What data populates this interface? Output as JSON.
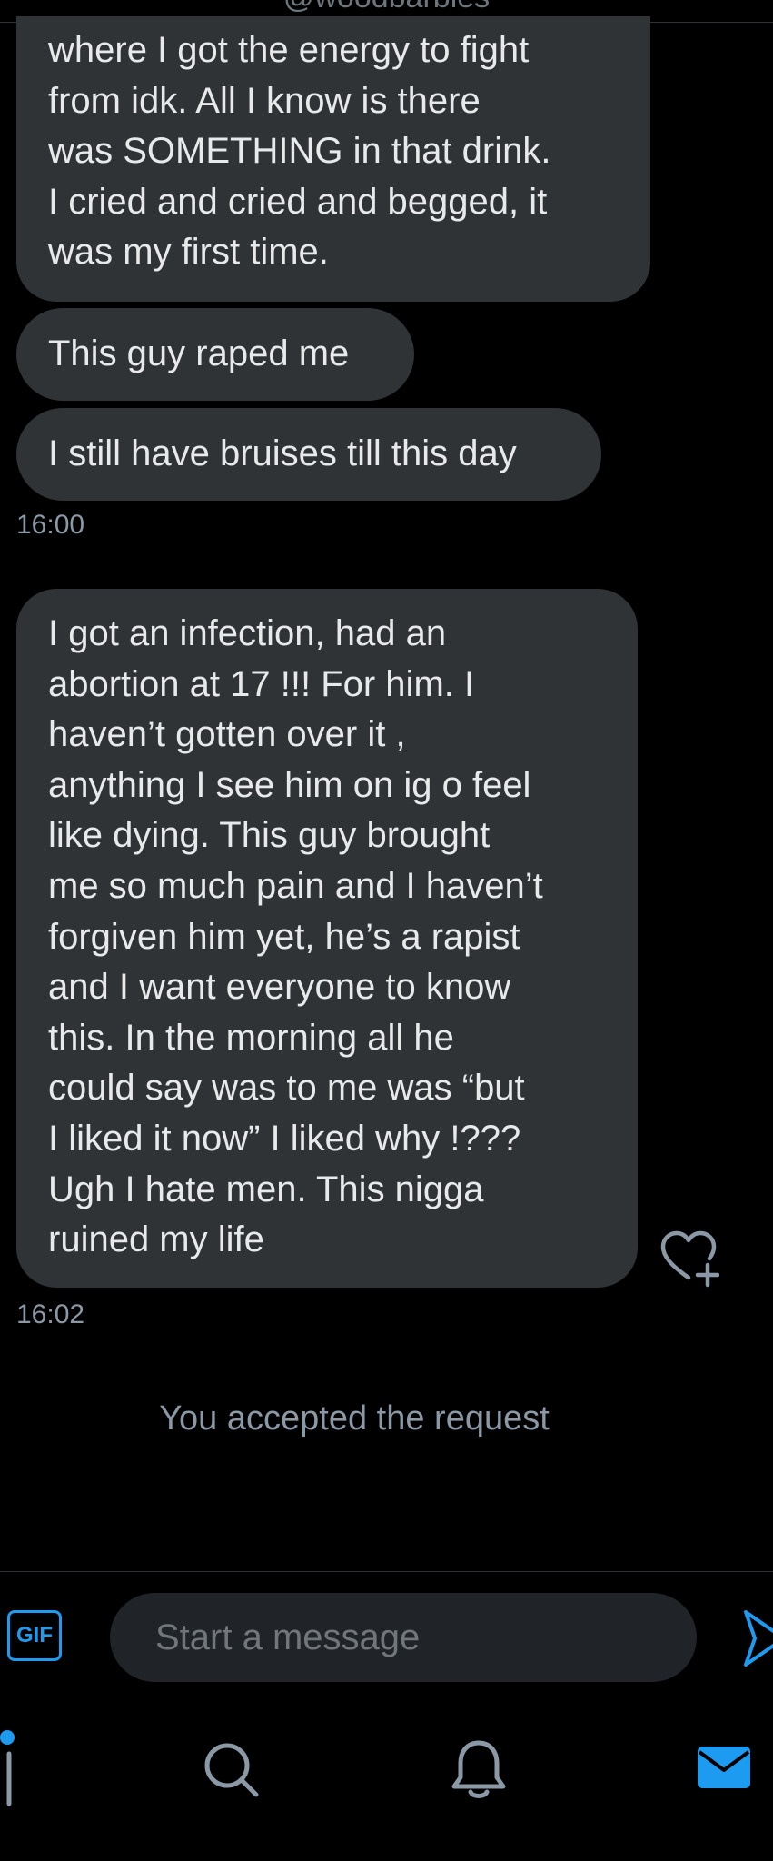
{
  "header": {
    "handle_partial": "@woodbarbies"
  },
  "messages": [
    {
      "text": "where I got the energy to fight\nfrom idk. All I know is there\nwas SOMETHING in that drink.\nI cried and cried and begged, it\nwas my first time."
    },
    {
      "text": "This guy raped me"
    },
    {
      "text": "I still have bruises till this day",
      "timestamp": "16:00"
    },
    {
      "text": "I got an infection, had an\nabortion at 17 !!! For him. I\nhaven’t gotten over it ,\nanything I see him on ig o feel\nlike dying. This guy brought\nme so much pain and I haven’t\nforgiven him yet, he’s a rapist\nand I want everyone to know\nthis. In the morning all he\ncould say was to me was  “but\nI liked it now” I liked why !???\nUgh I hate men. This nigga\nruined my life",
      "timestamp": "16:02"
    }
  ],
  "system_message": "You accepted the request",
  "composer": {
    "gif_label": "GIF",
    "placeholder": "Start a message"
  },
  "icons": {
    "react": "heart-plus-icon",
    "send": "send-icon",
    "nav": [
      "profile-icon",
      "search-icon",
      "bell-icon",
      "mail-icon"
    ]
  },
  "colors": {
    "background": "#000000",
    "bubble": "#2f3336",
    "text": "#e7e9ea",
    "muted": "#8b98a5",
    "accent": "#1d9bf0",
    "input_bg": "#202327"
  }
}
